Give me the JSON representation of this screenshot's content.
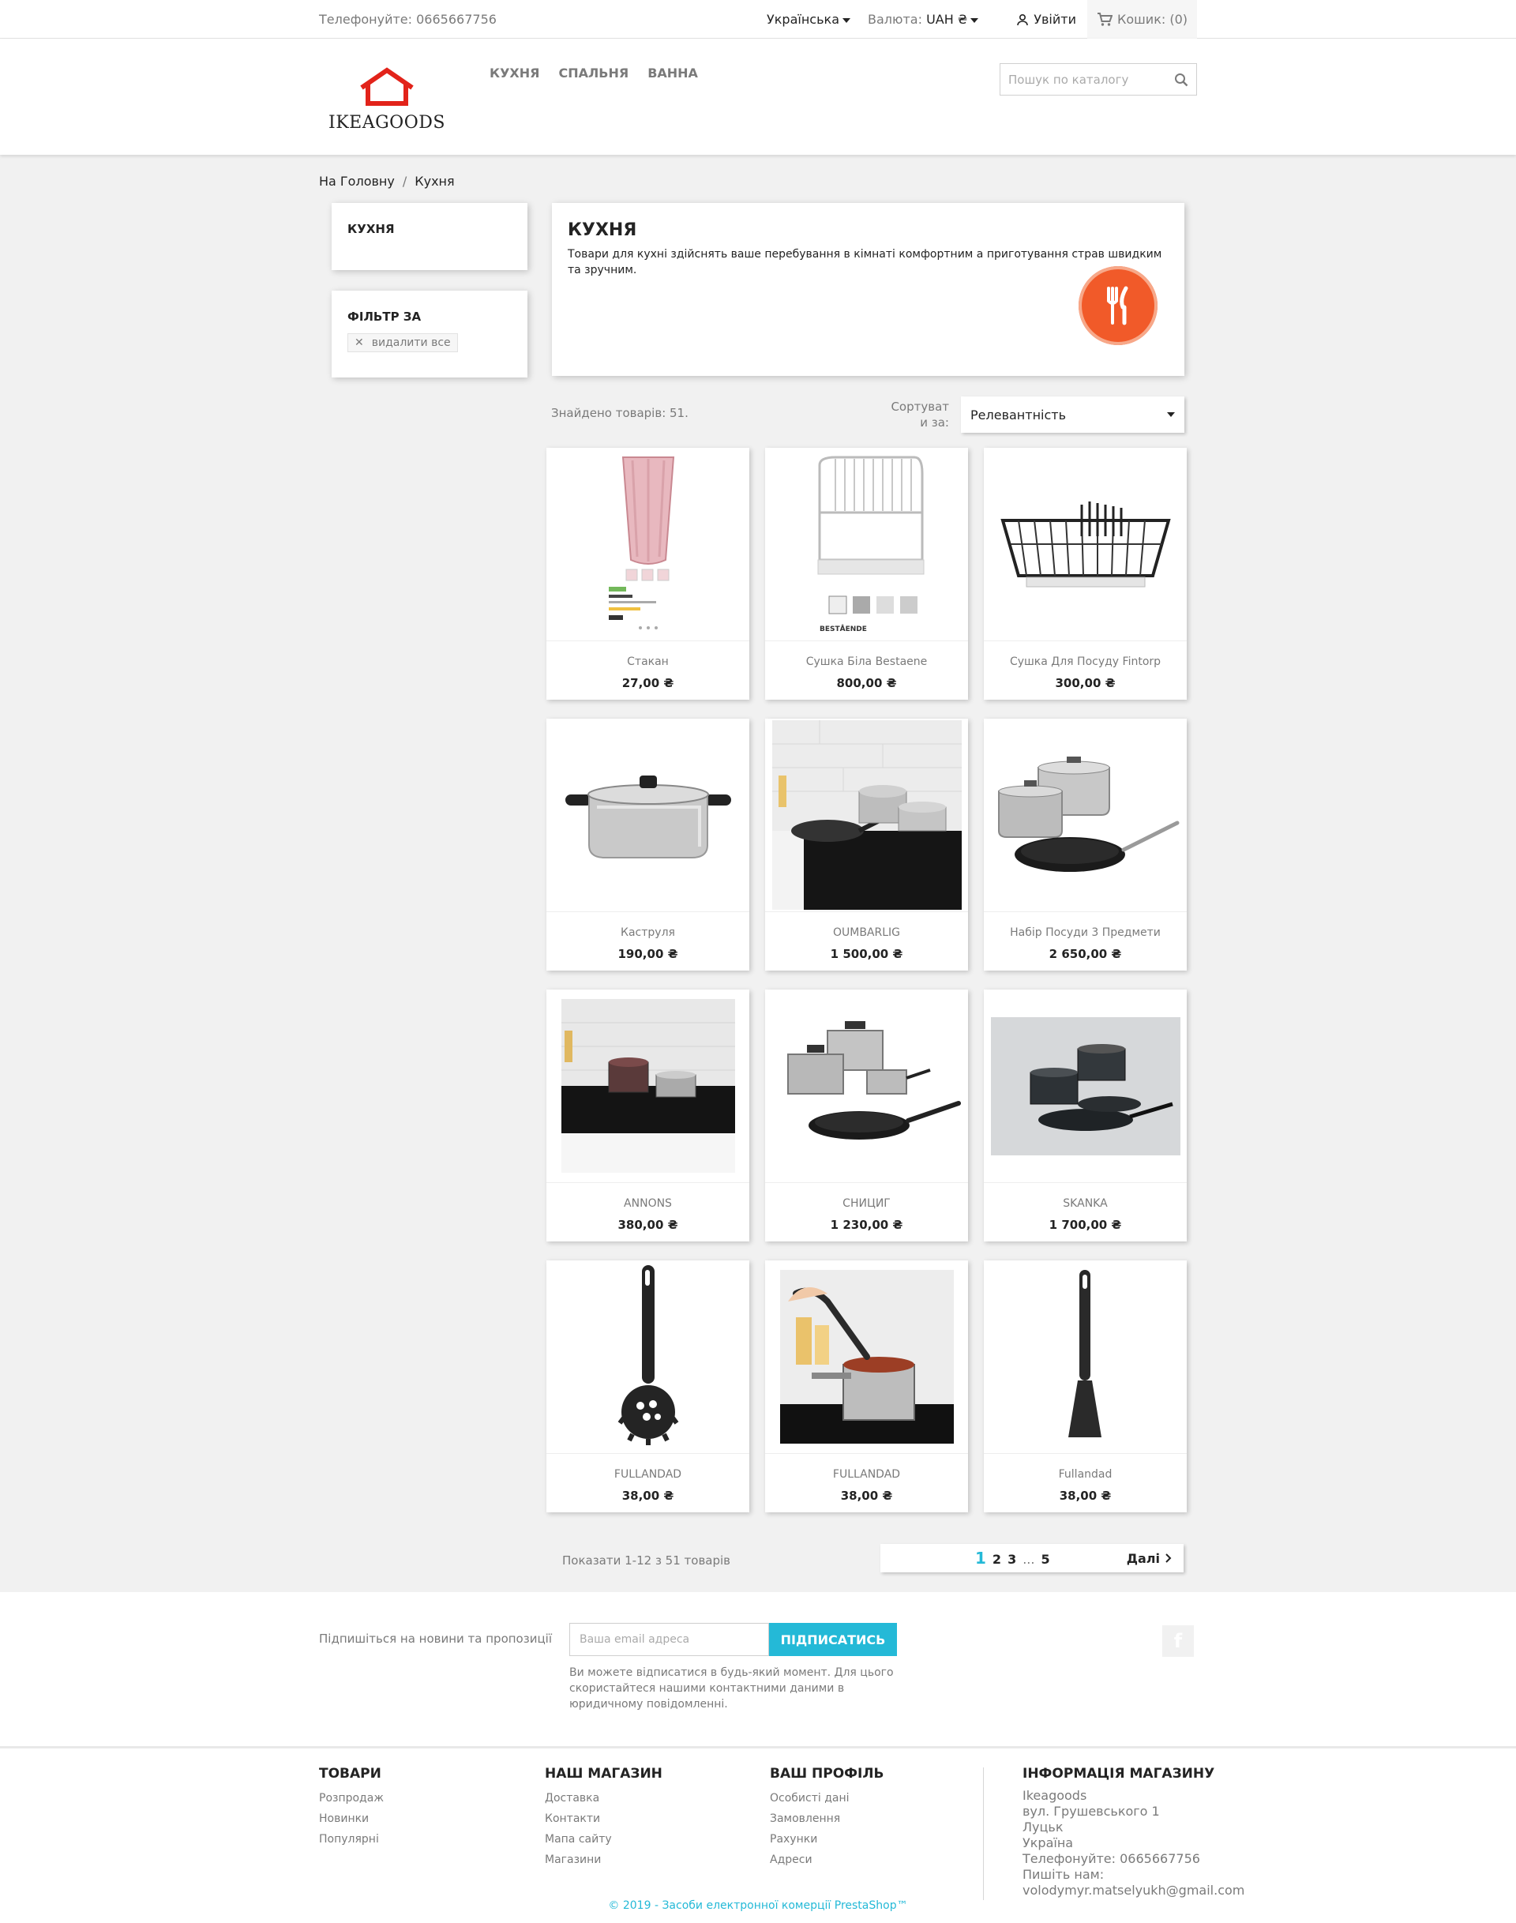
{
  "topbar": {
    "phone": "Телефонуйте: 0665667756",
    "language": "Українська",
    "currency_label": "Валюта:",
    "currency_value": "UAH ₴",
    "signin": "Увійти",
    "cart": "Кошик: (0)"
  },
  "header": {
    "logo_text": "IKEAGOODS",
    "menu": [
      "КУХНЯ",
      "СПАЛЬНЯ",
      "ВАННА"
    ],
    "search_placeholder": "Пошук по каталогу"
  },
  "breadcrumb": [
    "На Головну",
    "Кухня"
  ],
  "sidebar": {
    "category_title": "КУХНЯ",
    "filter_title": "ФІЛЬТР ЗА",
    "clear_all": "видалити все"
  },
  "category": {
    "title": "КУХНЯ",
    "description": "Товари для кухні здійснять ваше перебування в кімнаті комфортним а приготування страв швидким та зручним.",
    "icon": "fork-knife-icon",
    "accent": "#f15a29"
  },
  "listing": {
    "found": "Знайдено товарів: 51.",
    "sort_label": "Сортуват и за:",
    "sort_value": "Релевантність",
    "products": [
      {
        "name": "Стакан",
        "price": "27,00 ₴"
      },
      {
        "name": "Сушка Біла Bestaene",
        "price": "800,00 ₴"
      },
      {
        "name": "Сушка Для Посуду Fintorp",
        "price": "300,00 ₴"
      },
      {
        "name": "Каструля",
        "price": "190,00 ₴"
      },
      {
        "name": "OUMBARLIG",
        "price": "1 500,00 ₴"
      },
      {
        "name": "Набір Посуди 3 Предмети",
        "price": "2 650,00 ₴"
      },
      {
        "name": "ANNONS",
        "price": "380,00 ₴"
      },
      {
        "name": "СНИЦИГ",
        "price": "1 230,00 ₴"
      },
      {
        "name": "SKANKA",
        "price": "1 700,00 ₴"
      },
      {
        "name": "FULLANDAD",
        "price": "38,00 ₴"
      },
      {
        "name": "FULLANDAD",
        "price": "38,00 ₴"
      },
      {
        "name": "Fullandad",
        "price": "38,00 ₴"
      }
    ],
    "showing": "Показати 1-12 з 51 товарів",
    "pages": [
      "1",
      "2",
      "3",
      "...",
      "5"
    ],
    "next": "Далі"
  },
  "newsletter": {
    "label": "Підпишіться на новини та пропозиції",
    "placeholder": "Ваша email адреса",
    "button": "ПІДПИСАТИСЬ",
    "note": "Ви можете відписатися в будь-який момент. Для цього скористайтеся нашими контактними даними в юридичному повідомленні."
  },
  "footer": {
    "products_title": "ТОВАРИ",
    "products_links": [
      "Розпродаж",
      "Новинки",
      "Популярні"
    ],
    "store_title": "НАШ МАГАЗИН",
    "store_links": [
      "Доставка",
      "Контакти",
      "Мапа сайту",
      "Магазини"
    ],
    "profile_title": "ВАШ ПРОФІЛЬ",
    "profile_links": [
      "Особисті дані",
      "Замовлення",
      "Рахунки",
      "Адреси"
    ],
    "info_title": "ІНФОРМАЦІЯ МАГАЗИНУ",
    "info_lines": [
      "Ikeagoods",
      "вул. Грушевського 1",
      "Луцьк",
      "Україна",
      "Телефонуйте: 0665667756",
      "Пишіть нам:",
      "volodymyr.matselyukh@gmail.com"
    ],
    "copyright": "© 2019 - Засоби електронної комерції PrestaShop™"
  },
  "colors": {
    "accent": "#24b9d7",
    "logo_red": "#e2231a"
  }
}
